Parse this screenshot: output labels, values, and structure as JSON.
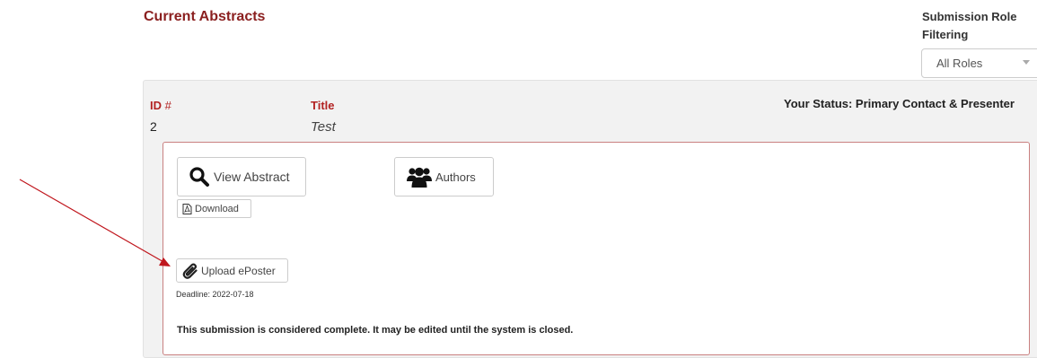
{
  "header": {
    "title": "Current Abstracts",
    "filter_label": "Submission Role Filtering",
    "filter_value": "All Roles"
  },
  "abstract": {
    "id_label": "ID",
    "id_hash": "#",
    "id_value": "2",
    "title_label": "Title",
    "title_value": "Test",
    "status": "Your Status: Primary Contact & Presenter"
  },
  "actions": {
    "view_label": "View Abstract",
    "authors_label": "Authors",
    "download_label": "Download",
    "upload_label": "Upload ePoster",
    "deadline": "Deadline: 2022-07-18"
  },
  "notice": "This submission is considered complete. It may be edited until the system is closed.",
  "colors": {
    "accent": "#8b2020",
    "label_red": "#b22222",
    "arrow": "#c0161d"
  }
}
